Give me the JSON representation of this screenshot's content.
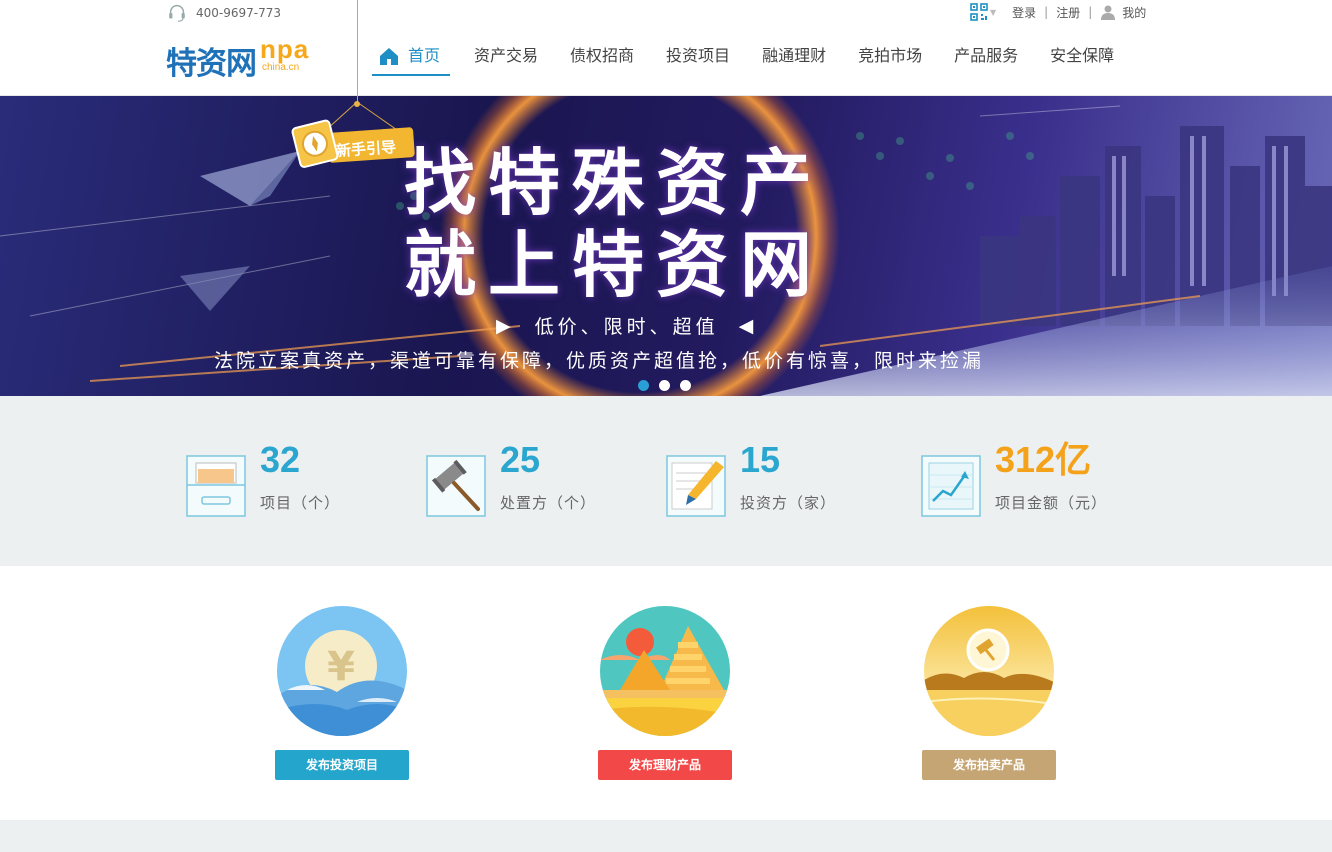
{
  "header": {
    "phone": "400-9697-773",
    "login": "登录",
    "register": "注册",
    "separator": "|",
    "me": "我的",
    "logo_cn": "特资网",
    "logo_en": "npa",
    "logo_domain": "china.cn"
  },
  "nav": {
    "items": [
      "首页",
      "资产交易",
      "债权招商",
      "投资项目",
      "融通理财",
      "竞拍市场",
      "产品服务",
      "安全保障"
    ],
    "active_index": 0
  },
  "guide": {
    "label": "新手引导"
  },
  "banner": {
    "line1": "找特殊资产",
    "line2": "就上特资网",
    "sub": "低价、限时、超值",
    "desc": "法院立案真资产，渠道可靠有保障，优质资产超值抢，低价有惊喜，限时来捡漏",
    "slide_count": 3,
    "active_slide": 0
  },
  "stats": [
    {
      "value": "32",
      "label": "项目（个）",
      "icon": "folder-icon"
    },
    {
      "value": "25",
      "label": "处置方（个）",
      "icon": "gavel-icon"
    },
    {
      "value": "15",
      "label": "投资方（家）",
      "icon": "pen-contract-icon"
    },
    {
      "value": "312亿",
      "label": "项目金额（元）",
      "icon": "chart-icon"
    }
  ],
  "publish": [
    {
      "label": "发布投资项目",
      "color": "#23a5cc"
    },
    {
      "label": "发布理财产品",
      "color": "#f24848"
    },
    {
      "label": "发布拍卖产品",
      "color": "#c6a574"
    }
  ],
  "colors": {
    "accent": "#1e8fc4",
    "stat_blue": "#2aa6cf",
    "stat_orange": "#f3a21a",
    "logo_blue": "#1f72b8",
    "logo_orange": "#f6a71a"
  }
}
